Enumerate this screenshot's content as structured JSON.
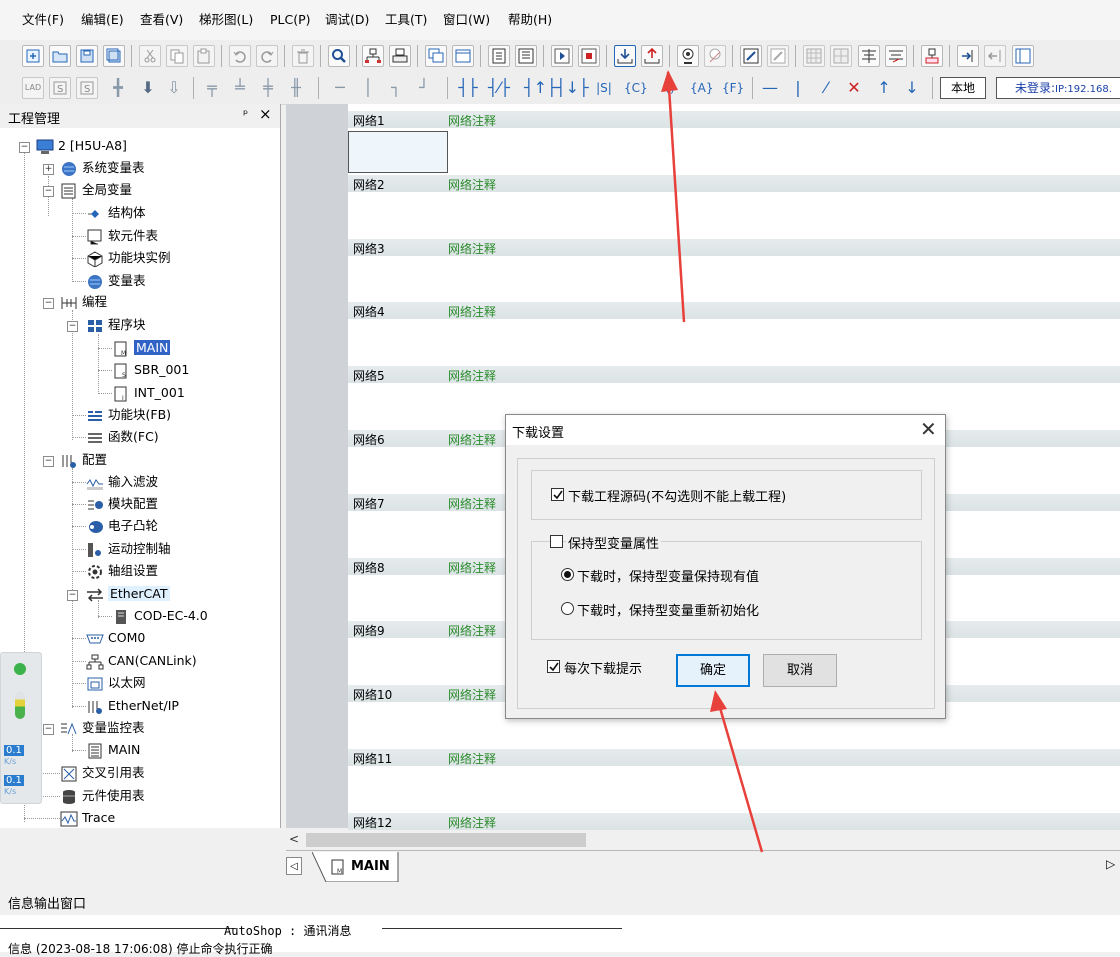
{
  "menu": [
    "文件(F)",
    "编辑(E)",
    "查看(V)",
    "梯形图(L)",
    "PLC(P)",
    "调试(D)",
    "工具(T)",
    "窗口(W)",
    "帮助(H)"
  ],
  "toolbar2": {
    "local_label": "本地",
    "login_label": "未登录:",
    "ip_label": "IP:192.168."
  },
  "panel": {
    "title": "工程管理",
    "pin_glyph": "ᵖ",
    "close_glyph": "×",
    "tree": [
      "2 [H5U-A8]",
      "系统变量表",
      "全局变量",
      "结构体",
      "软元件表",
      "功能块实例",
      "变量表",
      "编程",
      "程序块",
      "MAIN",
      "SBR_001",
      "INT_001",
      "功能块(FB)",
      "函数(FC)",
      "配置",
      "输入滤波",
      "模块配置",
      "电子凸轮",
      "运动控制轴",
      "轴组设置",
      "EtherCAT",
      "COD-EC-4.0",
      "COM0",
      "CAN(CANLink)",
      "以太网",
      "EtherNet/IP",
      "变量监控表",
      "MAIN",
      "交叉引用表",
      "元件使用表",
      "Trace"
    ]
  },
  "meter": {
    "v1": "0.1",
    "u1": "K/s",
    "v2": "0.1",
    "u2": "K/s"
  },
  "networks": [
    {
      "n": "网络1",
      "c": "网络注释"
    },
    {
      "n": "网络2",
      "c": "网络注释"
    },
    {
      "n": "网络3",
      "c": "网络注释"
    },
    {
      "n": "网络4",
      "c": "网络注释"
    },
    {
      "n": "网络5",
      "c": "网络注释"
    },
    {
      "n": "网络6",
      "c": "网络注释"
    },
    {
      "n": "网络7",
      "c": "网络注释"
    },
    {
      "n": "网络8",
      "c": "网络注释"
    },
    {
      "n": "网络9",
      "c": "网络注释"
    },
    {
      "n": "网络10",
      "c": "网络注释"
    },
    {
      "n": "网络11",
      "c": "网络注释"
    },
    {
      "n": "网络12",
      "c": "网络注释"
    }
  ],
  "tab": {
    "label": "MAIN"
  },
  "info": {
    "title": "信息输出窗口",
    "line1": "AutoShop : 通讯消息",
    "line2": "信息  (2023-08-18 17:06:08)  停止命令执行正确"
  },
  "dialog": {
    "title": "下载设置",
    "close_glyph": "✕",
    "download_source": "下载工程源码(不勾选则不能上载工程)",
    "retain_group": "保持型变量属性",
    "radio_keep": "下载时，保持型变量保持现有值",
    "radio_reinit": "下载时，保持型变量重新初始化",
    "prompt_each": "每次下载提示",
    "ok": "确定",
    "cancel": "取消"
  }
}
